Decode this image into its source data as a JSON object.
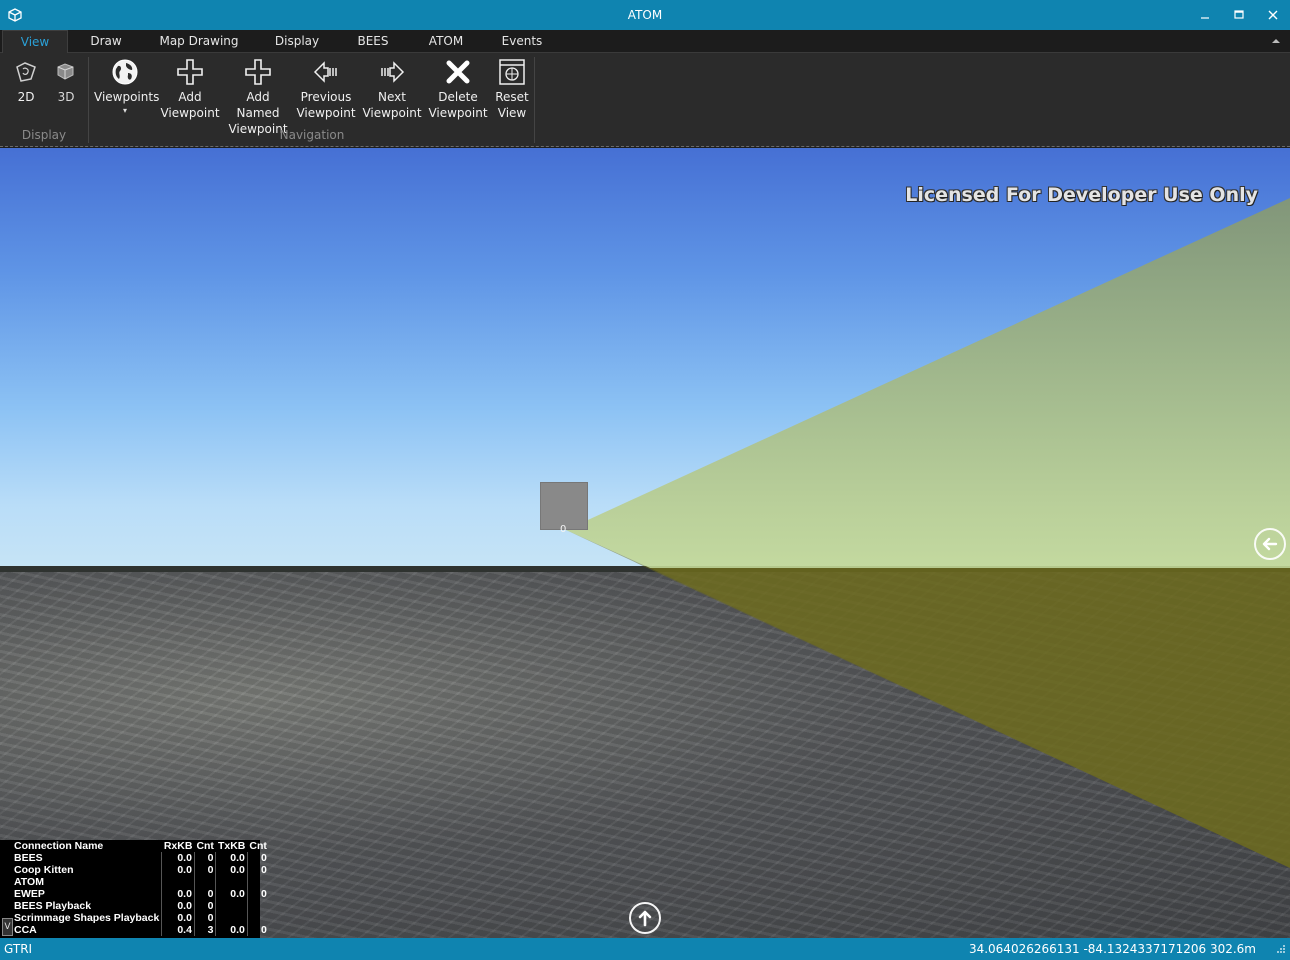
{
  "window": {
    "title": "ATOM",
    "minimize_icon": "minimize-icon",
    "maximize_icon": "maximize-icon",
    "close_icon": "close-icon"
  },
  "tabs": [
    {
      "label": "View",
      "active": true
    },
    {
      "label": "Draw"
    },
    {
      "label": "Map Drawing"
    },
    {
      "label": "Display"
    },
    {
      "label": "BEES"
    },
    {
      "label": "ATOM"
    },
    {
      "label": "Events"
    }
  ],
  "ribbon": {
    "display_group": {
      "label": "Display",
      "buttons": [
        {
          "label": "2D",
          "icon": "map-2d-icon"
        },
        {
          "label": "3D",
          "icon": "map-3d-icon"
        }
      ]
    },
    "viewpoints": {
      "label": "Viewpoints",
      "icon": "globe-icon",
      "dropdown": "▾"
    },
    "navigation_group": {
      "label": "Navigation",
      "buttons": [
        {
          "line1": "Add",
          "line2": "Viewpoint",
          "icon": "plus-icon"
        },
        {
          "line1": "Add Named",
          "line2": "Viewpoint",
          "icon": "plus-icon"
        },
        {
          "line1": "Previous",
          "line2": "Viewpoint",
          "icon": "arrow-left-icon"
        },
        {
          "line1": "Next",
          "line2": "Viewpoint",
          "icon": "arrow-right-icon"
        },
        {
          "line1": "Delete",
          "line2": "Viewpoint",
          "icon": "x-icon"
        },
        {
          "line1": "Reset",
          "line2": "View",
          "icon": "reset-view-icon"
        }
      ]
    }
  },
  "viewport": {
    "license_text": "Licensed For Developer Use Only",
    "cube_label": "0",
    "colors": {
      "cone": "#a8c86a",
      "cone_ground": "#6f6d1c"
    }
  },
  "connections": {
    "headers": [
      "Connection Name",
      "RxKB",
      "Cnt",
      "TxKB",
      "Cnt"
    ],
    "rows": [
      [
        "BEES",
        "0.0",
        "0",
        "0.0",
        "0"
      ],
      [
        "Coop Kitten",
        "0.0",
        "0",
        "0.0",
        "0"
      ],
      [
        "ATOM",
        "",
        "",
        "",
        ""
      ],
      [
        "EWEP",
        "0.0",
        "0",
        "0.0",
        "0"
      ],
      [
        "BEES Playback",
        "0.0",
        "0",
        "",
        ""
      ],
      [
        "Scrimmage Shapes Playback",
        "0.0",
        "0",
        "",
        ""
      ],
      [
        "CCA",
        "0.4",
        "3",
        "0.0",
        "0"
      ]
    ],
    "toggle_label": "V"
  },
  "status": {
    "left": "GTRI",
    "coordinates": "34.064026266131 -84.1324337171206  302.6m"
  }
}
